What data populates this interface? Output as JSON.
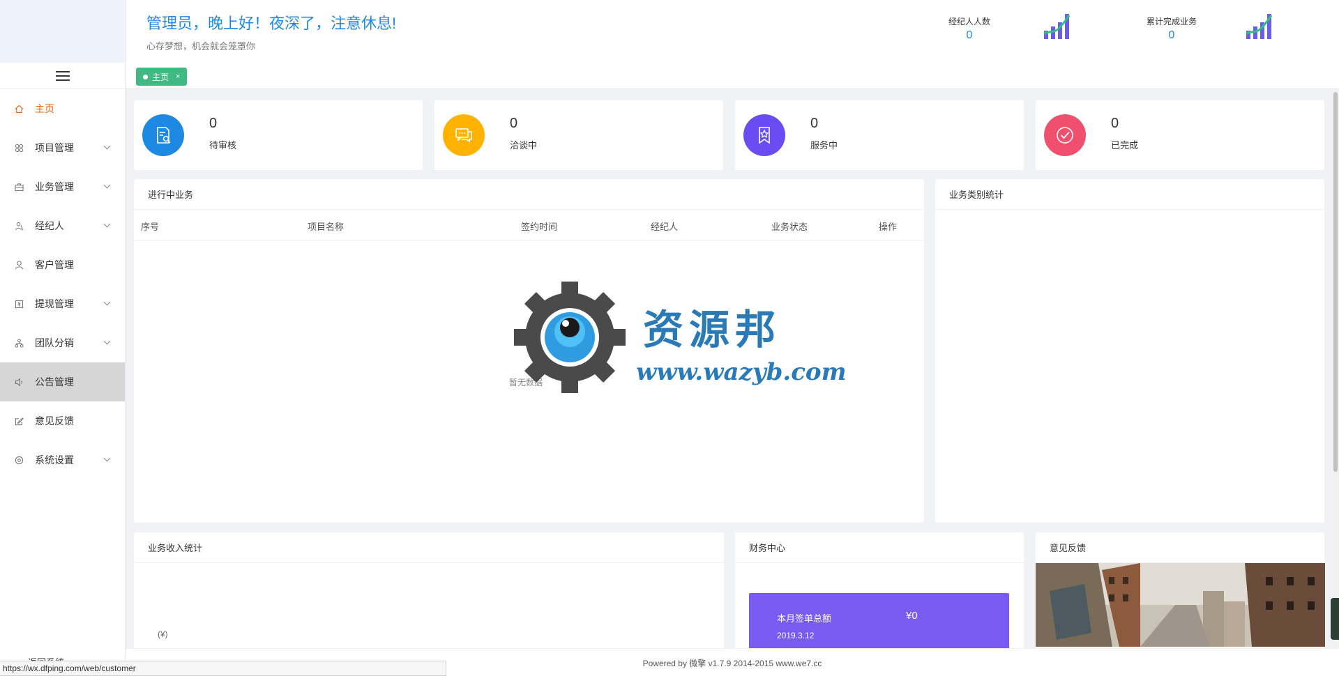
{
  "header": {
    "greeting": "管理员，晚上好！夜深了，注意休息!",
    "subtitle": "心存梦想，机会就会笼罩你",
    "stats": [
      {
        "label": "经纪人人数",
        "value": "0"
      },
      {
        "label": "累计完成业务",
        "value": "0"
      }
    ]
  },
  "tabs": [
    {
      "label": "主页",
      "close": "×"
    }
  ],
  "sidebar": {
    "items": [
      {
        "label": "主页",
        "icon": "home-icon"
      },
      {
        "label": "项目管理",
        "icon": "grid-icon"
      },
      {
        "label": "业务管理",
        "icon": "briefcase-icon"
      },
      {
        "label": "经纪人",
        "icon": "people-icon"
      },
      {
        "label": "客户管理",
        "icon": "user-icon"
      },
      {
        "label": "提现管理",
        "icon": "wallet-icon"
      },
      {
        "label": "团队分销",
        "icon": "team-icon"
      },
      {
        "label": "公告管理",
        "icon": "speaker-icon"
      },
      {
        "label": "意见反馈",
        "icon": "edit-icon"
      },
      {
        "label": "系统设置",
        "icon": "settings-icon"
      }
    ],
    "back_label": "返回系统"
  },
  "kpis": [
    {
      "value": "0",
      "label": "待审核",
      "color": "#1e88e5",
      "icon": "document-search-icon"
    },
    {
      "value": "0",
      "label": "洽谈中",
      "color": "#ffb300",
      "icon": "chat-icon"
    },
    {
      "value": "0",
      "label": "服务中",
      "color": "#6a4cf3",
      "icon": "bookmark-star-icon"
    },
    {
      "value": "0",
      "label": "已完成",
      "color": "#f0506e",
      "icon": "check-circle-icon"
    }
  ],
  "ongoing": {
    "title": "进行中业务",
    "columns": [
      "序号",
      "项目名称",
      "签约时间",
      "经纪人",
      "业务状态",
      "操作"
    ],
    "empty": "暂无数据"
  },
  "category_stats": {
    "title": "业务类别统计"
  },
  "income": {
    "title": "业务收入统计",
    "unit": "(¥)"
  },
  "finance": {
    "title": "财务中心",
    "month_total_label": "本月签单总额",
    "month_total_value": "¥0",
    "date": "2019.3.12"
  },
  "feedback": {
    "title": "意见反馈"
  },
  "watermark": {
    "title": "资源邦",
    "url": "www.wazyb.com"
  },
  "footer": {
    "powered": "Powered by 微擎 v1.7.9 2014-2015 www.we7.cc"
  },
  "status_url": "https://wx.dfping.com/web/customer"
}
